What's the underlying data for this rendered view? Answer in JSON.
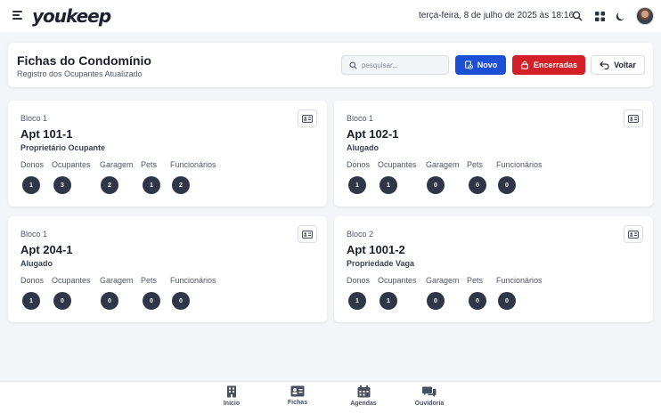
{
  "app": {
    "logo_text": "youkeep"
  },
  "topbar": {
    "datetime": "terça-feira, 8 de julho de 2025 às 18:16",
    "icons": [
      "menu-icon",
      "search-icon",
      "apps-grid-icon",
      "moon-icon",
      "avatar"
    ]
  },
  "header": {
    "title": "Fichas do Condomínio",
    "subtitle": "Registro dos Ocupantes Atualizado",
    "search_placeholder": "pesquisar...",
    "btn_novo": "Novo",
    "btn_encerradas": "Encerradas",
    "btn_voltar": "Voltar"
  },
  "colors": {
    "primary": "#1a4fd6",
    "danger": "#d32028",
    "badge": "#2f3648"
  },
  "stat_labels": [
    "Donos",
    "Ocupantes",
    "Garagem",
    "Pets",
    "Funcionários"
  ],
  "units": [
    {
      "bloco": "Bloco 1",
      "apt": "Apt 101-1",
      "status": "Proprietário Ocupante",
      "stats": [
        "1",
        "3",
        "2",
        "1",
        "2"
      ]
    },
    {
      "bloco": "Bloco 1",
      "apt": "Apt 102-1",
      "status": "Alugado",
      "stats": [
        "1",
        "1",
        "0",
        "0",
        "0"
      ]
    },
    {
      "bloco": "Bloco 1",
      "apt": "Apt 204-1",
      "status": "Alugado",
      "stats": [
        "1",
        "0",
        "0",
        "0",
        "0"
      ]
    },
    {
      "bloco": "Bloco 2",
      "apt": "Apt 1001-2",
      "status": "Propriedade Vaga",
      "stats": [
        "1",
        "1",
        "0",
        "0",
        "0"
      ]
    }
  ],
  "bottom_nav": [
    {
      "label": "Início",
      "icon": "building-icon"
    },
    {
      "label": "Fichas",
      "icon": "id-card-icon"
    },
    {
      "label": "Agendas",
      "icon": "calendar-icon"
    },
    {
      "label": "Ouvidoria",
      "icon": "chat-icon"
    }
  ]
}
